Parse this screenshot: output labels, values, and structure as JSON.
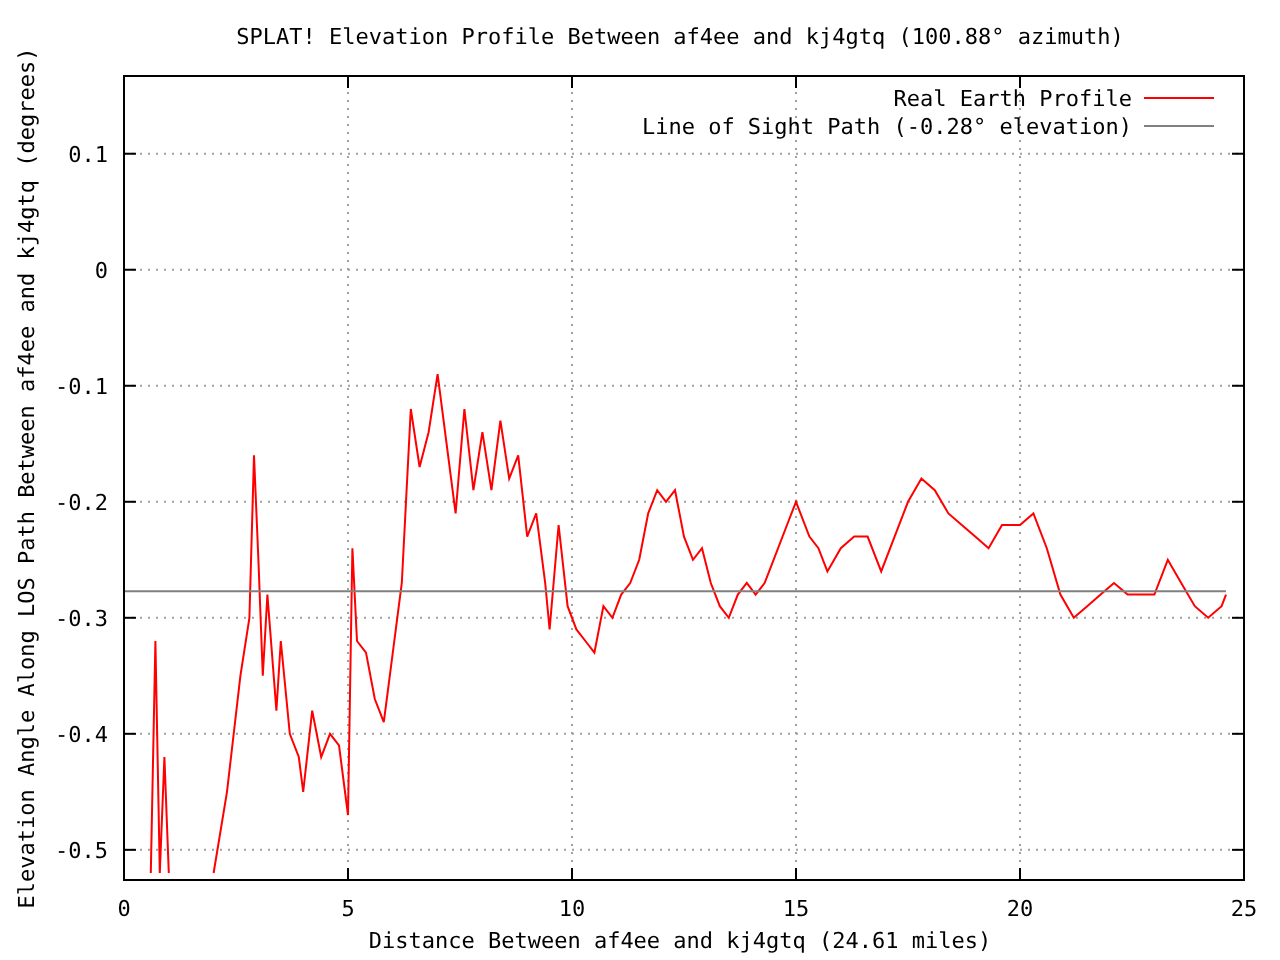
{
  "chart_data": {
    "type": "line",
    "title": "SPLAT! Elevation Profile Between af4ee and kj4gtq (100.88° azimuth)",
    "xlabel": "Distance Between af4ee and kj4gtq (24.61 miles)",
    "ylabel": "Elevation Angle Along LOS Path Between af4ee and kj4gtq (degrees)",
    "x": [
      0,
      0.6,
      0.7,
      0.8,
      0.9,
      1.0,
      1.9,
      2.0,
      2.3,
      2.6,
      2.8,
      2.9,
      3.0,
      3.1,
      3.2,
      3.4,
      3.5,
      3.7,
      3.9,
      4.0,
      4.2,
      4.4,
      4.6,
      4.8,
      5.0,
      5.1,
      5.2,
      5.4,
      5.6,
      5.8,
      6.0,
      6.2,
      6.4,
      6.6,
      6.8,
      7.0,
      7.2,
      7.4,
      7.6,
      7.8,
      8.0,
      8.2,
      8.4,
      8.6,
      8.8,
      9.0,
      9.2,
      9.4,
      9.5,
      9.7,
      9.9,
      10.1,
      10.3,
      10.5,
      10.7,
      10.9,
      11.1,
      11.3,
      11.5,
      11.7,
      11.9,
      12.1,
      12.3,
      12.5,
      12.7,
      12.9,
      13.1,
      13.3,
      13.5,
      13.7,
      13.9,
      14.1,
      14.3,
      14.5,
      14.8,
      15.0,
      15.3,
      15.5,
      15.7,
      16.0,
      16.3,
      16.6,
      16.9,
      17.2,
      17.5,
      17.8,
      18.1,
      18.4,
      18.7,
      19.0,
      19.3,
      19.6,
      20.0,
      20.3,
      20.6,
      20.9,
      21.2,
      21.5,
      21.8,
      22.1,
      22.4,
      22.7,
      23.0,
      23.3,
      23.6,
      23.9,
      24.2,
      24.5,
      24.6
    ],
    "series": [
      {
        "name": "Real Earth Profile",
        "color": "#ff0000",
        "values": [
          null,
          -0.52,
          -0.32,
          -0.52,
          -0.42,
          -0.52,
          null,
          -0.52,
          -0.45,
          -0.35,
          -0.3,
          -0.16,
          -0.25,
          -0.35,
          -0.28,
          -0.38,
          -0.32,
          -0.4,
          -0.42,
          -0.45,
          -0.38,
          -0.42,
          -0.4,
          -0.41,
          -0.47,
          -0.24,
          -0.32,
          -0.33,
          -0.37,
          -0.39,
          -0.33,
          -0.27,
          -0.12,
          -0.17,
          -0.14,
          -0.09,
          -0.15,
          -0.21,
          -0.12,
          -0.19,
          -0.14,
          -0.19,
          -0.13,
          -0.18,
          -0.16,
          -0.23,
          -0.21,
          -0.27,
          -0.31,
          -0.22,
          -0.29,
          -0.31,
          -0.32,
          -0.33,
          -0.29,
          -0.3,
          -0.28,
          -0.27,
          -0.25,
          -0.21,
          -0.19,
          -0.2,
          -0.19,
          -0.23,
          -0.25,
          -0.24,
          -0.27,
          -0.29,
          -0.3,
          -0.28,
          -0.27,
          -0.28,
          -0.27,
          -0.25,
          -0.22,
          -0.2,
          -0.23,
          -0.24,
          -0.26,
          -0.24,
          -0.23,
          -0.23,
          -0.26,
          -0.23,
          -0.2,
          -0.18,
          -0.19,
          -0.21,
          -0.22,
          -0.23,
          -0.24,
          -0.22,
          -0.22,
          -0.21,
          -0.24,
          -0.28,
          -0.3,
          -0.29,
          -0.28,
          -0.27,
          -0.28,
          -0.28,
          -0.28,
          -0.25,
          -0.27,
          -0.29,
          -0.3,
          -0.29,
          -0.28
        ]
      },
      {
        "name": "Line of Sight Path (-0.28° elevation)",
        "color": "#808080",
        "values": [
          -0.277,
          -0.277,
          -0.277,
          -0.277,
          -0.277,
          -0.277,
          -0.277,
          -0.277,
          -0.277,
          -0.277,
          -0.277,
          -0.277,
          -0.277,
          -0.277,
          -0.277,
          -0.277,
          -0.277,
          -0.277,
          -0.277,
          -0.277,
          -0.277,
          -0.277,
          -0.277,
          -0.277,
          -0.277,
          -0.277,
          -0.277,
          -0.277,
          -0.277,
          -0.277,
          -0.277,
          -0.277,
          -0.277,
          -0.277,
          -0.277,
          -0.277,
          -0.277,
          -0.277,
          -0.277,
          -0.277,
          -0.277,
          -0.277,
          -0.277,
          -0.277,
          -0.277,
          -0.277,
          -0.277,
          -0.277,
          -0.277,
          -0.277,
          -0.277,
          -0.277,
          -0.277,
          -0.277,
          -0.277,
          -0.277,
          -0.277,
          -0.277,
          -0.277,
          -0.277,
          -0.277,
          -0.277,
          -0.277,
          -0.277,
          -0.277,
          -0.277,
          -0.277,
          -0.277,
          -0.277,
          -0.277,
          -0.277,
          -0.277,
          -0.277,
          -0.277,
          -0.277,
          -0.277,
          -0.277,
          -0.277,
          -0.277,
          -0.277,
          -0.277,
          -0.277,
          -0.277,
          -0.277,
          -0.277,
          -0.277,
          -0.277,
          -0.277,
          -0.277,
          -0.277,
          -0.277,
          -0.277,
          -0.277,
          -0.277,
          -0.277,
          -0.277,
          -0.277,
          -0.277,
          -0.277,
          -0.277,
          -0.277,
          -0.277,
          -0.277,
          -0.277,
          -0.277,
          -0.277,
          -0.277,
          -0.277,
          -0.277
        ]
      }
    ],
    "xlim": [
      0,
      25
    ],
    "ylim": [
      -0.526,
      0.167
    ],
    "xticks": [
      0,
      5,
      10,
      15,
      20,
      25
    ],
    "yticks": [
      -0.5,
      -0.4,
      -0.3,
      -0.2,
      -0.1,
      0,
      0.1
    ],
    "grid": true,
    "legend": true
  }
}
